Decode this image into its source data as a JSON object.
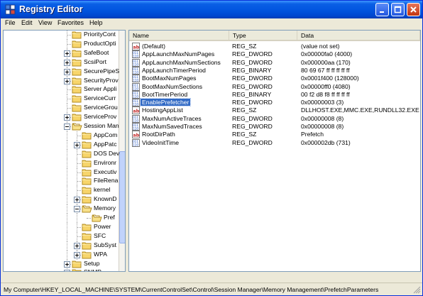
{
  "window": {
    "title": "Registry Editor"
  },
  "menu": [
    "File",
    "Edit",
    "View",
    "Favorites",
    "Help"
  ],
  "tree": [
    {
      "label": "PriorityCont",
      "expander": "none"
    },
    {
      "label": "ProductOpti",
      "expander": "none"
    },
    {
      "label": "SafeBoot",
      "expander": "plus"
    },
    {
      "label": "ScsiPort",
      "expander": "plus"
    },
    {
      "label": "SecurePipeS",
      "expander": "plus"
    },
    {
      "label": "SecurityProv",
      "expander": "plus"
    },
    {
      "label": "Server Appli",
      "expander": "none"
    },
    {
      "label": "ServiceCurr",
      "expander": "none"
    },
    {
      "label": "ServiceGrou",
      "expander": "none"
    },
    {
      "label": "ServiceProv",
      "expander": "plus"
    },
    {
      "label": "Session Man",
      "expander": "minus"
    },
    {
      "label": "AppCom",
      "expander": "none"
    },
    {
      "label": "AppPatc",
      "expander": "plus"
    },
    {
      "label": "DOS Dev",
      "expander": "none"
    },
    {
      "label": "Environr",
      "expander": "none"
    },
    {
      "label": "Executiv",
      "expander": "none"
    },
    {
      "label": "FileRena",
      "expander": "none"
    },
    {
      "label": "kernel",
      "expander": "none"
    },
    {
      "label": "KnownD",
      "expander": "plus"
    },
    {
      "label": "Memory",
      "expander": "minus"
    },
    {
      "label": "Pref",
      "expander": "none"
    },
    {
      "label": "Power",
      "expander": "none"
    },
    {
      "label": "SFC",
      "expander": "none"
    },
    {
      "label": "SubSyst",
      "expander": "plus"
    },
    {
      "label": "WPA",
      "expander": "plus"
    },
    {
      "label": "Setup",
      "expander": "plus"
    },
    {
      "label": "SNMP",
      "expander": "plus"
    }
  ],
  "columns": {
    "name": "Name",
    "type": "Type",
    "data": "Data"
  },
  "values": [
    {
      "icon": "string",
      "name": "(Default)",
      "type": "REG_SZ",
      "data": "(value not set)"
    },
    {
      "icon": "binary",
      "name": "AppLaunchMaxNumPages",
      "type": "REG_DWORD",
      "data": "0x00000fa0 (4000)"
    },
    {
      "icon": "binary",
      "name": "AppLaunchMaxNumSections",
      "type": "REG_DWORD",
      "data": "0x000000aa (170)"
    },
    {
      "icon": "binary",
      "name": "AppLaunchTimerPeriod",
      "type": "REG_BINARY",
      "data": "80 69 67 ff ff ff ff ff"
    },
    {
      "icon": "binary",
      "name": "BootMaxNumPages",
      "type": "REG_DWORD",
      "data": "0x0001f400 (128000)"
    },
    {
      "icon": "binary",
      "name": "BootMaxNumSections",
      "type": "REG_DWORD",
      "data": "0x00000ff0 (4080)"
    },
    {
      "icon": "binary",
      "name": "BootTimerPeriod",
      "type": "REG_BINARY",
      "data": "00 f2 d8 f8 ff ff ff ff"
    },
    {
      "icon": "binary",
      "name": "EnablePrefetcher",
      "type": "REG_DWORD",
      "data": "0x00000003 (3)",
      "selected": true
    },
    {
      "icon": "string",
      "name": "HostingAppList",
      "type": "REG_SZ",
      "data": "DLLHOST.EXE,MMC.EXE,RUNDLL32.EXE"
    },
    {
      "icon": "binary",
      "name": "MaxNumActiveTraces",
      "type": "REG_DWORD",
      "data": "0x00000008 (8)"
    },
    {
      "icon": "binary",
      "name": "MaxNumSavedTraces",
      "type": "REG_DWORD",
      "data": "0x00000008 (8)"
    },
    {
      "icon": "string",
      "name": "RootDirPath",
      "type": "REG_SZ",
      "data": "Prefetch"
    },
    {
      "icon": "binary",
      "name": "VideoInitTime",
      "type": "REG_DWORD",
      "data": "0x000002db (731)"
    }
  ],
  "status": "My Computer\\HKEY_LOCAL_MACHINE\\SYSTEM\\CurrentControlSet\\Control\\Session Manager\\Memory Management\\PrefetchParameters"
}
